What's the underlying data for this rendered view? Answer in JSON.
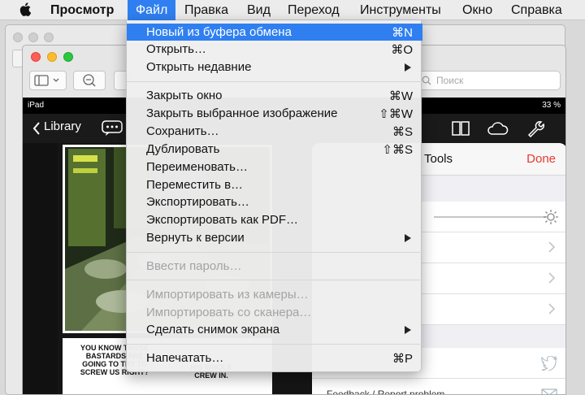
{
  "menubar": {
    "app_name": "Просмотр",
    "items": [
      "Файл",
      "Правка",
      "Вид",
      "Переход",
      "Инструменты",
      "Окно",
      "Справка"
    ]
  },
  "window": {
    "search_placeholder": "Поиск"
  },
  "ipad": {
    "device": "iPad",
    "battery": "33 %",
    "back_label": "Library",
    "tools_title": "Tools",
    "done_label": "Done",
    "last_row_label": "Feedback / Report problem",
    "comic_text_1": "YOU KNOW THOSE BASTARDS ARE GOING TO TRY TO SCREW US RIGHT?",
    "comic_text_2": "HIS WHOLE CREW IN."
  },
  "file_menu": {
    "items": [
      {
        "label": "Новый из буфера обмена",
        "shortcut": "⌘N",
        "highlighted": true
      },
      {
        "label": "Открыть…",
        "shortcut": "⌘O"
      },
      {
        "label": "Открыть недавние",
        "submenu": true
      },
      {
        "label": "Закрыть окно",
        "shortcut": "⌘W"
      },
      {
        "label": "Закрыть выбранное изображение",
        "shortcut": "⇧⌘W"
      },
      {
        "label": "Сохранить…",
        "shortcut": "⌘S"
      },
      {
        "label": "Дублировать",
        "shortcut": "⇧⌘S"
      },
      {
        "label": "Переименовать…"
      },
      {
        "label": "Переместить в…"
      },
      {
        "label": "Экспортировать…"
      },
      {
        "label": "Экспортировать как PDF…"
      },
      {
        "label": "Вернуть к версии",
        "submenu": true
      },
      {
        "label": "Ввести пароль…",
        "disabled": true
      },
      {
        "label": "Импортировать из камеры…",
        "disabled": true
      },
      {
        "label": "Импортировать со сканера…",
        "disabled": true
      },
      {
        "label": "Сделать снимок экрана",
        "submenu": true
      },
      {
        "label": "Напечатать…",
        "shortcut": "⌘P"
      }
    ]
  },
  "colors": {
    "accent": "#2f7ff1",
    "done": "#e53a2e"
  }
}
